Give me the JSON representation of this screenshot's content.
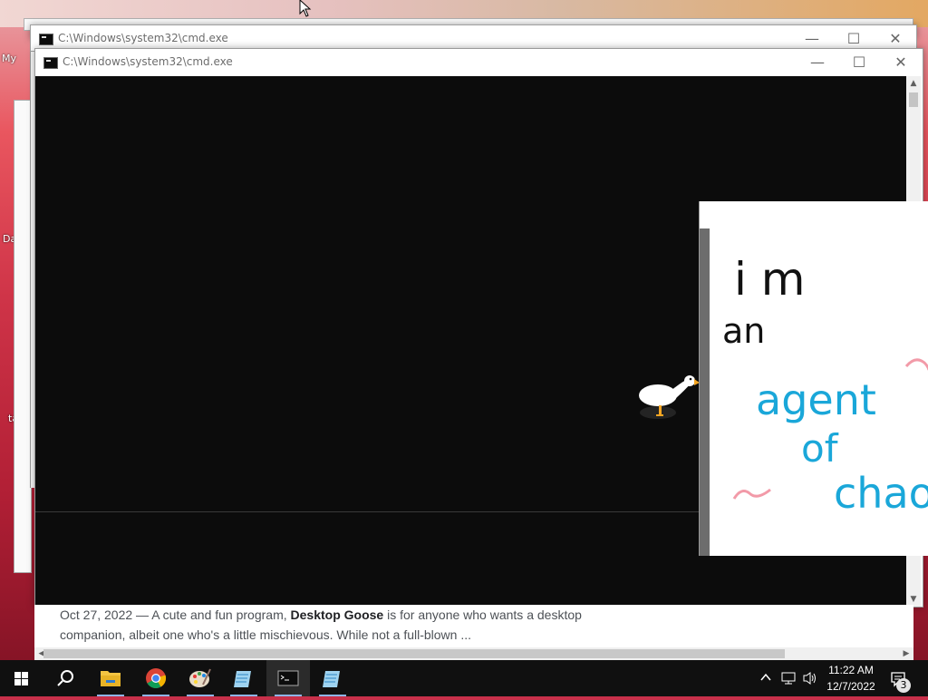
{
  "desktop": {
    "icon_labels": [
      "My",
      "Da",
      "ta"
    ]
  },
  "back_window": {
    "title": "C:\\Windows\\system32\\cmd.exe"
  },
  "front_window": {
    "title": "C:\\Windows\\system32\\cmd.exe"
  },
  "window_buttons": {
    "minimize": "—",
    "maximize": "☐",
    "close": "✕"
  },
  "scrollbar": {
    "up": "▲",
    "down": "▼",
    "left": "◀",
    "right": "▶"
  },
  "search_result": {
    "date": "Oct 27, 2022",
    "separator": " — ",
    "text_before": "A cute and fun program, ",
    "bold": "Desktop Goose",
    "text_after": " is for anyone who wants a desktop companion, albeit one who's a little mischievous. While not a full-blown ..."
  },
  "notepad": {
    "line1": "i m",
    "line2": "an",
    "line3": "agent",
    "line4": "of",
    "line5": "chao"
  },
  "taskbar": {
    "apps": [
      "start",
      "search",
      "file-explorer",
      "chrome",
      "paint",
      "notepad",
      "cmd",
      "notepad"
    ],
    "time": "11:22 AM",
    "date": "12/7/2022",
    "notification_count": "3"
  },
  "colors": {
    "console_bg": "#0c0c0c",
    "accent": "#8fb5e8",
    "ink_black": "#111111",
    "ink_blue": "#1aa7d9",
    "ink_pink": "#f29aa8"
  }
}
